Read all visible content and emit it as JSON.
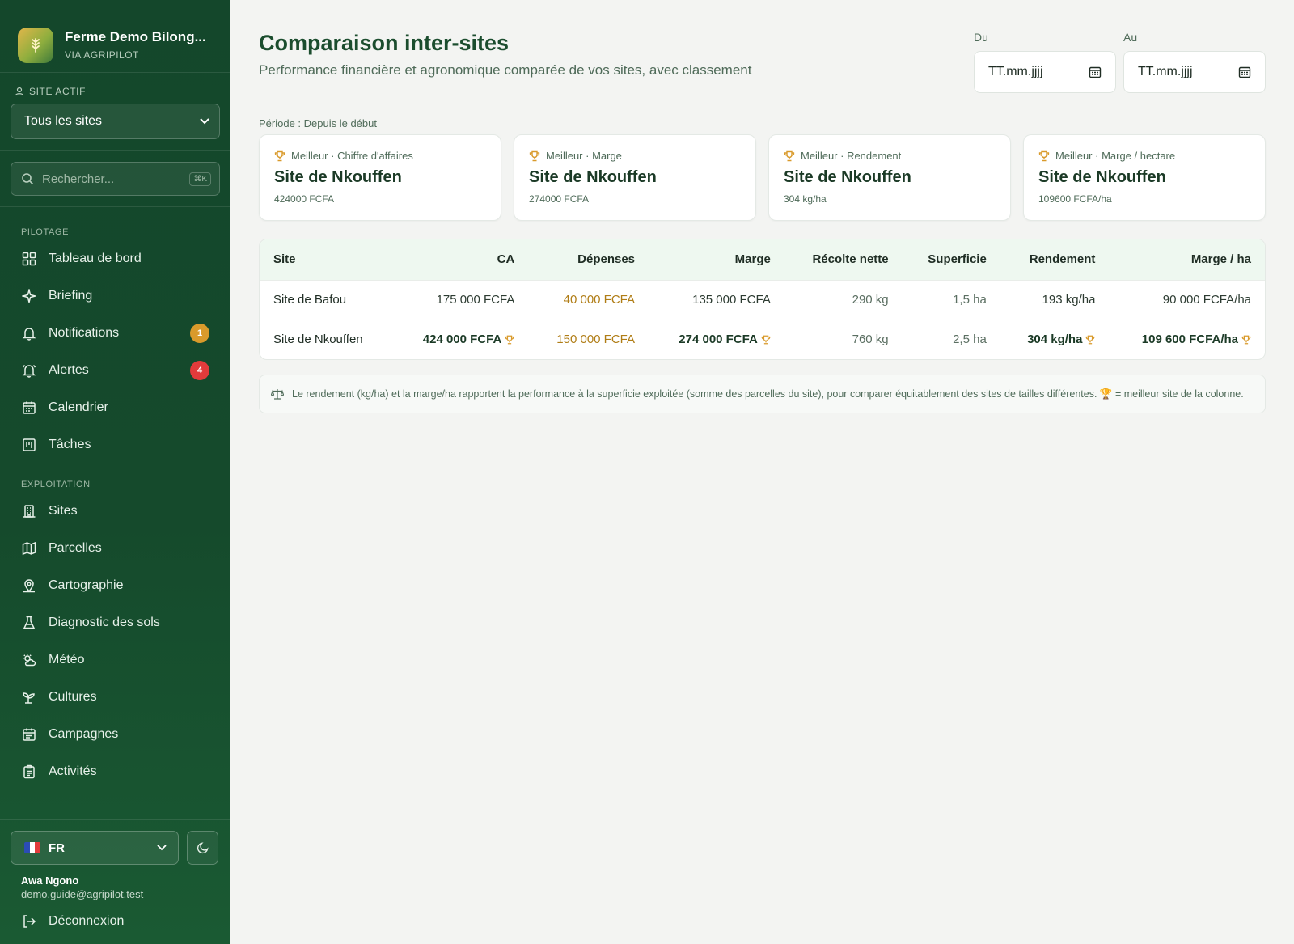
{
  "brand": {
    "title": "Ferme Demo Bilong...",
    "subtitle": "VIA AGRIPILOT"
  },
  "site_selector": {
    "label": "SITE ACTIF",
    "value": "Tous les sites"
  },
  "search": {
    "placeholder": "Rechercher...",
    "shortcut": "⌘K"
  },
  "nav": {
    "section_pilotage": "PILOTAGE",
    "pilotage": [
      {
        "label": "Tableau de bord",
        "icon": "dashboard-icon"
      },
      {
        "label": "Briefing",
        "icon": "sparkle-icon"
      },
      {
        "label": "Notifications",
        "icon": "bell-icon",
        "badge": "1"
      },
      {
        "label": "Alertes",
        "icon": "alarm-icon",
        "badge": "4"
      },
      {
        "label": "Calendrier",
        "icon": "calendar-icon"
      },
      {
        "label": "Tâches",
        "icon": "kanban-icon"
      }
    ],
    "section_exploitation": "EXPLOITATION",
    "exploitation": [
      {
        "label": "Sites",
        "icon": "building-icon"
      },
      {
        "label": "Parcelles",
        "icon": "map-icon"
      },
      {
        "label": "Cartographie",
        "icon": "map-pin-icon"
      },
      {
        "label": "Diagnostic des sols",
        "icon": "flask-icon"
      },
      {
        "label": "Météo",
        "icon": "weather-icon"
      },
      {
        "label": "Cultures",
        "icon": "sprout-icon"
      },
      {
        "label": "Campagnes",
        "icon": "calendar-days-icon"
      },
      {
        "label": "Activités",
        "icon": "clipboard-icon"
      }
    ]
  },
  "language": {
    "code": "FR"
  },
  "user": {
    "name": "Awa Ngono",
    "email": "demo.guide@agripilot.test",
    "logout": "Déconnexion"
  },
  "header": {
    "title": "Comparaison inter-sites",
    "subtitle": "Performance financière et agronomique comparée de vos sites, avec classement"
  },
  "dates": {
    "from_label": "Du",
    "from_value": "TT.mm.jjjj",
    "to_label": "Au",
    "to_value": "TT.mm.jjjj"
  },
  "period": "Période : Depuis le début",
  "best_cards": [
    {
      "label": "Meilleur · Chiffre d'affaires",
      "site": "Site de Nkouffen",
      "value": "424000 FCFA"
    },
    {
      "label": "Meilleur · Marge",
      "site": "Site de Nkouffen",
      "value": "274000 FCFA"
    },
    {
      "label": "Meilleur · Rendement",
      "site": "Site de Nkouffen",
      "value": "304 kg/ha"
    },
    {
      "label": "Meilleur · Marge / hectare",
      "site": "Site de Nkouffen",
      "value": "109600 FCFA/ha"
    }
  ],
  "table": {
    "columns": [
      "Site",
      "CA",
      "Dépenses",
      "Marge",
      "Récolte nette",
      "Superficie",
      "Rendement",
      "Marge / ha"
    ],
    "rows": [
      {
        "site": "Site de Bafou",
        "ca": "175 000 FCFA",
        "depenses": "40 000 FCFA",
        "marge": "135 000 FCFA",
        "recolte": "290 kg",
        "superficie": "1,5 ha",
        "rendement": "193 kg/ha",
        "marge_ha": "90 000 FCFA/ha"
      },
      {
        "site": "Site de Nkouffen",
        "ca": "424 000 FCFA",
        "depenses": "150 000 FCFA",
        "marge": "274 000 FCFA",
        "recolte": "760 kg",
        "superficie": "2,5 ha",
        "rendement": "304 kg/ha",
        "marge_ha": "109 600 FCFA/ha"
      }
    ]
  },
  "note": "Le rendement (kg/ha) et la marge/ha rapportent la performance à la superficie exploitée (somme des parcelles du site), pour comparer équitablement des sites de tailles différentes. 🏆 = meilleur site de la colonne.",
  "colors": {
    "sidebar": "#154a2c",
    "accent": "#1b4d2e",
    "trophy": "#d99a2b",
    "expense": "#b07d16"
  }
}
